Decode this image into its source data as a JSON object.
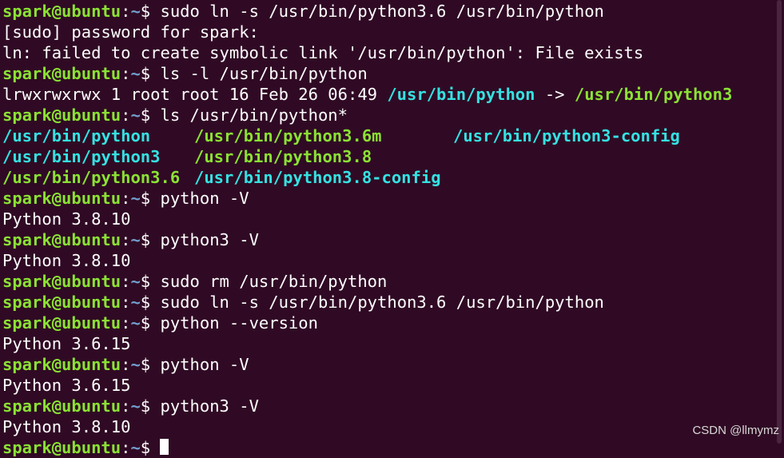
{
  "prompt": {
    "user": "spark@ubuntu",
    "sep": ":",
    "path": "~",
    "dollar": "$ "
  },
  "lines": [
    {
      "type": "cmd",
      "text": "sudo ln -s /usr/bin/python3.6 /usr/bin/python"
    },
    {
      "type": "out",
      "text": "[sudo] password for spark:"
    },
    {
      "type": "out",
      "text": "ln: failed to create symbolic link '/usr/bin/python': File exists"
    },
    {
      "type": "cmd",
      "text": "ls -l /usr/bin/python"
    },
    {
      "type": "lsl",
      "prefix": "lrwxrwxrwx 1 root root 16 Feb 26 06:49 ",
      "link": "/usr/bin/python",
      "arrow": " -> ",
      "target": "/usr/bin/python3"
    },
    {
      "type": "cmd",
      "text": "ls /usr/bin/python*"
    },
    {
      "type": "lsgrid",
      "items": [
        {
          "text": "/usr/bin/python",
          "color": "cyan"
        },
        {
          "text": "/usr/bin/python3.6m",
          "color": "green"
        },
        {
          "text": "/usr/bin/python3-config",
          "color": "cyan"
        },
        {
          "text": "/usr/bin/python3",
          "color": "cyan"
        },
        {
          "text": "/usr/bin/python3.8",
          "color": "green"
        },
        {
          "text": "",
          "color": "none"
        },
        {
          "text": "/usr/bin/python3.6",
          "color": "green"
        },
        {
          "text": "/usr/bin/python3.8-config",
          "color": "cyan"
        },
        {
          "text": "",
          "color": "none"
        }
      ]
    },
    {
      "type": "cmd",
      "text": "python -V"
    },
    {
      "type": "out",
      "text": "Python 3.8.10"
    },
    {
      "type": "cmd",
      "text": "python3 -V"
    },
    {
      "type": "out",
      "text": "Python 3.8.10"
    },
    {
      "type": "cmd",
      "text": "sudo rm /usr/bin/python"
    },
    {
      "type": "cmd",
      "text": "sudo ln -s /usr/bin/python3.6 /usr/bin/python"
    },
    {
      "type": "cmd",
      "text": "python --version"
    },
    {
      "type": "out",
      "text": "Python 3.6.15"
    },
    {
      "type": "cmd",
      "text": "python -V"
    },
    {
      "type": "out",
      "text": "Python 3.6.15"
    },
    {
      "type": "cmd",
      "text": "python3 -V"
    },
    {
      "type": "out",
      "text": "Python 3.8.10"
    },
    {
      "type": "active",
      "text": ""
    }
  ],
  "watermark": "CSDN @llmymz",
  "colors": {
    "background": "#300a24",
    "user": "#8ae234",
    "path": "#729fcf",
    "link": "#34e2e2",
    "exec": "#8ae234"
  }
}
